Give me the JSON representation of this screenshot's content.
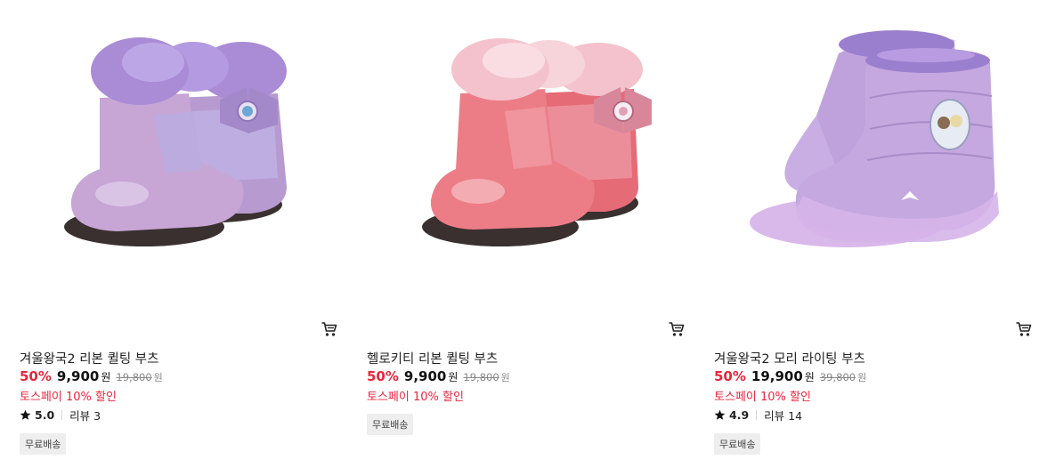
{
  "products": [
    {
      "name": "겨울왕국2 리본 퀼팅 부츠",
      "discount": "50%",
      "price": "9,900",
      "unit": "원",
      "original_price": "19,800",
      "original_unit": "원",
      "promo": "토스페이 10% 할인",
      "rating": "5.0",
      "review_text": "리뷰 3",
      "badge": "무료배송",
      "image": {
        "kind": "ribbon-boot",
        "color": "#c7a6d6",
        "fur": "#a98bd6",
        "sole": "#3a3030"
      }
    },
    {
      "name": "헬로키티 리본 퀼팅 부츠",
      "discount": "50%",
      "price": "9,900",
      "unit": "원",
      "original_price": "19,800",
      "original_unit": "원",
      "promo": "토스페이 10% 할인",
      "image": {
        "kind": "ribbon-boot",
        "color": "#ec7d86",
        "fur": "#f4c2cc",
        "sole": "#3a3030"
      },
      "badge": "무료배송"
    },
    {
      "name": "겨울왕국2 모리 라이팅 부츠",
      "discount": "50%",
      "price": "19,900",
      "unit": "원",
      "original_price": "39,800",
      "original_unit": "원",
      "promo": "토스페이 10% 할인",
      "rating": "4.9",
      "review_text": "리뷰 14",
      "badge": "무료배송",
      "image": {
        "kind": "puffer-boot",
        "color": "#c5a8df",
        "fur": "#9b7fcf",
        "sole": "#d9b8ea"
      }
    }
  ],
  "icons": {
    "cart": "cart-icon",
    "star": "star-icon"
  },
  "colors": {
    "discount": "#e8263c",
    "promo": "#e8263c",
    "badge_bg": "#eeeeee"
  }
}
